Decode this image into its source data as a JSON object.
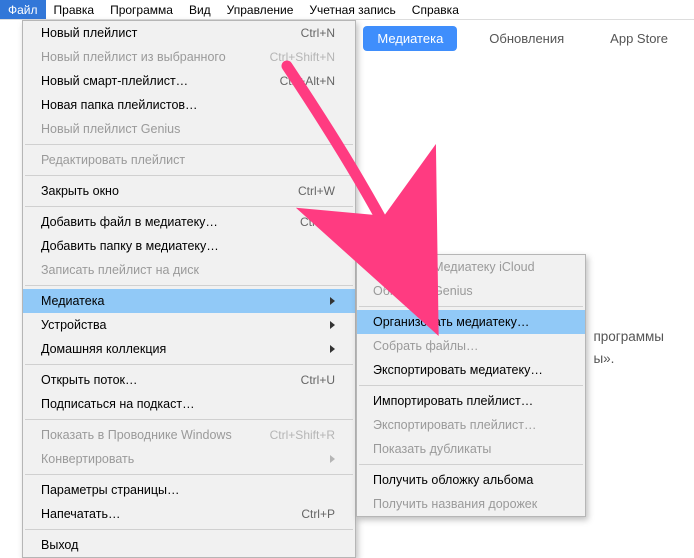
{
  "menubar": {
    "items": [
      "Файл",
      "Правка",
      "Программа",
      "Вид",
      "Управление",
      "Учетная запись",
      "Справка"
    ],
    "activeIndex": 0
  },
  "tabs": {
    "items": [
      "Медиатека",
      "Обновления",
      "App Store"
    ],
    "activeIndex": 0
  },
  "bg": {
    "line1": "программы",
    "line2": "ы»."
  },
  "dropdown": [
    {
      "type": "item",
      "label": "Новый плейлист",
      "shortcut": "Ctrl+N"
    },
    {
      "type": "item",
      "label": "Новый плейлист из выбранного",
      "shortcut": "Ctrl+Shift+N",
      "disabled": true
    },
    {
      "type": "item",
      "label": "Новый смарт-плейлист…",
      "shortcut": "Ctrl+Alt+N"
    },
    {
      "type": "item",
      "label": "Новая папка плейлистов…"
    },
    {
      "type": "item",
      "label": "Новый плейлист Genius",
      "disabled": true
    },
    {
      "type": "sep"
    },
    {
      "type": "item",
      "label": "Редактировать плейлист",
      "disabled": true
    },
    {
      "type": "sep"
    },
    {
      "type": "item",
      "label": "Закрыть окно",
      "shortcut": "Ctrl+W"
    },
    {
      "type": "sep"
    },
    {
      "type": "item",
      "label": "Добавить файл в медиатеку…",
      "shortcut": "Ctrl+O"
    },
    {
      "type": "item",
      "label": "Добавить папку в медиатеку…"
    },
    {
      "type": "item",
      "label": "Записать плейлист на диск",
      "disabled": true
    },
    {
      "type": "sep"
    },
    {
      "type": "item",
      "label": "Медиатека",
      "submenu": true,
      "highlight": true
    },
    {
      "type": "item",
      "label": "Устройства",
      "submenu": true
    },
    {
      "type": "item",
      "label": "Домашняя коллекция",
      "submenu": true
    },
    {
      "type": "sep"
    },
    {
      "type": "item",
      "label": "Открыть поток…",
      "shortcut": "Ctrl+U"
    },
    {
      "type": "item",
      "label": "Подписаться на подкаст…"
    },
    {
      "type": "sep"
    },
    {
      "type": "item",
      "label": "Показать в Проводнике Windows",
      "shortcut": "Ctrl+Shift+R",
      "disabled": true
    },
    {
      "type": "item",
      "label": "Конвертировать",
      "submenu": true,
      "disabled": true
    },
    {
      "type": "sep"
    },
    {
      "type": "item",
      "label": "Параметры страницы…"
    },
    {
      "type": "item",
      "label": "Напечатать…",
      "shortcut": "Ctrl+P"
    },
    {
      "type": "sep"
    },
    {
      "type": "item",
      "label": "Выход"
    }
  ],
  "submenu": [
    {
      "type": "item",
      "label": "Обновить Медиатеку iCloud",
      "disabled": true
    },
    {
      "type": "item",
      "label": "Обновить Genius",
      "disabled": true
    },
    {
      "type": "sep"
    },
    {
      "type": "item",
      "label": "Организовать медиатеку…",
      "highlight": true
    },
    {
      "type": "item",
      "label": "Собрать файлы…",
      "disabled": true
    },
    {
      "type": "item",
      "label": "Экспортировать медиатеку…"
    },
    {
      "type": "sep"
    },
    {
      "type": "item",
      "label": "Импортировать плейлист…"
    },
    {
      "type": "item",
      "label": "Экспортировать плейлист…",
      "disabled": true
    },
    {
      "type": "item",
      "label": "Показать дубликаты",
      "disabled": true
    },
    {
      "type": "sep"
    },
    {
      "type": "item",
      "label": "Получить обложку альбома"
    },
    {
      "type": "item",
      "label": "Получить названия дорожек",
      "disabled": true
    }
  ],
  "arrowColor": "#ff3b81"
}
